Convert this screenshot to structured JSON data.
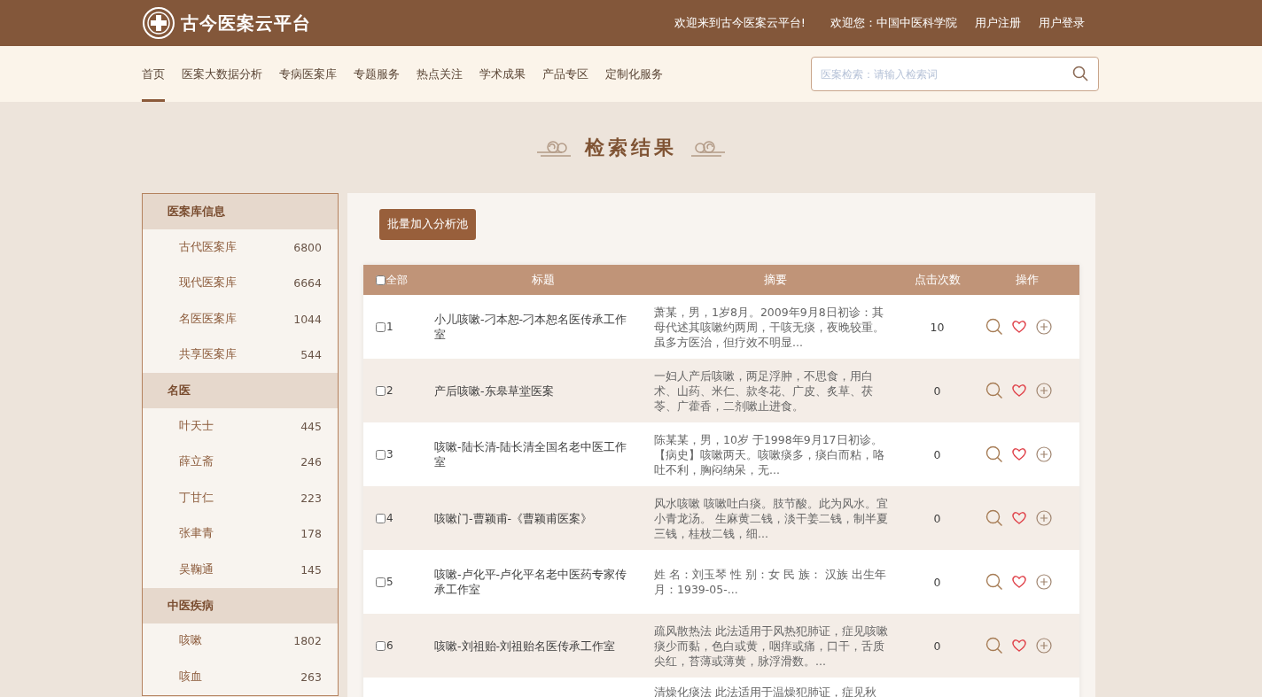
{
  "header": {
    "logo_text": "古今医案云平台",
    "welcome": "欢迎来到古今医案云平台!",
    "user": "欢迎您：中国中医科学院",
    "links": [
      "用户注册",
      "用户登录"
    ]
  },
  "nav": {
    "items": [
      {
        "label": "首页",
        "selected": true
      },
      {
        "label": "医案大数据分析",
        "selected": false
      },
      {
        "label": "专病医案库",
        "selected": false
      },
      {
        "label": "专题服务",
        "selected": false
      },
      {
        "label": "热点关注",
        "selected": false
      },
      {
        "label": "学术成果",
        "selected": false
      },
      {
        "label": "产品专区",
        "selected": false
      },
      {
        "label": "定制化服务",
        "selected": false
      }
    ],
    "search": {
      "placeholder": "医案检索：请输入检索词"
    }
  },
  "page_title": "检索结果",
  "sidebar": {
    "groups": [
      {
        "title": "医案库信息",
        "items": [
          {
            "label": "古代医案库",
            "count": "6800"
          },
          {
            "label": "现代医案库",
            "count": "6664"
          },
          {
            "label": "名医医案库",
            "count": "1044"
          },
          {
            "label": "共享医案库",
            "count": "544"
          }
        ]
      },
      {
        "title": "名医",
        "items": [
          {
            "label": "叶天士",
            "count": "445"
          },
          {
            "label": "薛立斋",
            "count": "246"
          },
          {
            "label": "丁甘仁",
            "count": "223"
          },
          {
            "label": "张聿青",
            "count": "178"
          },
          {
            "label": "吴鞠通",
            "count": "145"
          }
        ]
      },
      {
        "title": "中医疾病",
        "items": [
          {
            "label": "咳嗽",
            "count": "1802"
          },
          {
            "label": "咳血",
            "count": "263"
          }
        ]
      }
    ]
  },
  "batch_button": "批量加入分析池",
  "table": {
    "select_all": {
      "label": "全部",
      "checked": false
    },
    "columns": [
      "标题",
      "摘要",
      "点击次数",
      "操作"
    ],
    "rows": [
      {
        "index": "1",
        "checked": false,
        "title": "小儿咳嗽-刁本恕-刁本恕名医传承工作室",
        "summary": "萧某，男，1岁8月。2009年9月8日初诊：其母代述其咳嗽约两周，干咳无痰，夜晚较重。虽多方医治，但疗效不明显...",
        "clicks": "10"
      },
      {
        "index": "2",
        "checked": false,
        "title": "产后咳嗽-东皋草堂医案",
        "summary": "一妇人产后咳嗽，两足浮肿，不思食，用白术、山药、米仁、款冬花、广皮、炙草、茯苓、广藿香，二剂嗽止进食。",
        "clicks": "0"
      },
      {
        "index": "3",
        "checked": false,
        "title": "咳嗽-陆长清-陆长清全国名老中医工作室",
        "summary": "陈某某，男，10岁 于1998年9月17日初诊。【病史】咳嗽两天。咳嗽痰多，痰白而粘，咯吐不利，胸闷纳呆，无...",
        "clicks": "0"
      },
      {
        "index": "4",
        "checked": false,
        "title": "咳嗽门-曹颖甫-《曹颖甫医案》",
        "summary": "风水咳嗽 咳嗽吐白痰。肢节酸。此为风水。宜小青龙汤。 生麻黄二钱，淡干姜二钱，制半夏三钱，桂枝二钱，细...",
        "clicks": "0"
      },
      {
        "index": "5",
        "checked": false,
        "title": "咳嗽-卢化平-卢化平名老中医药专家传承工作室",
        "summary": "姓 名：刘玉琴 性 别：女 民 族： 汉族 出生年月：1939-05-...",
        "clicks": "0"
      },
      {
        "index": "6",
        "checked": false,
        "title": "咳嗽-刘祖贻-刘祖贻名医传承工作室",
        "summary": "疏风散热法 此法适用于风热犯肺证，症见咳嗽痰少而黏，色白或黄，咽痒或痛，口干，舌质尖红，苔薄或薄黄，脉浮滑数。...",
        "clicks": "0"
      },
      {
        "summary": "清燥化痰法 此法适用于温燥犯肺证，症见秋"
      }
    ]
  }
}
